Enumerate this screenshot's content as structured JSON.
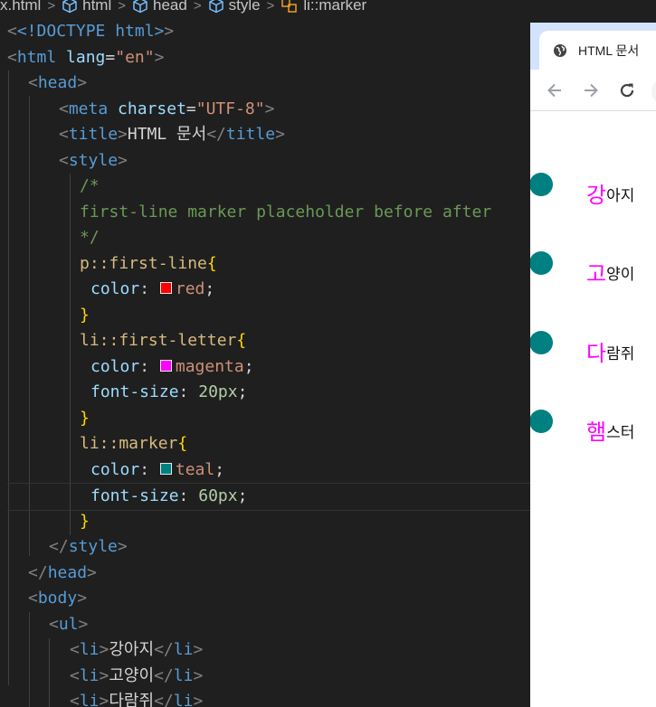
{
  "breadcrumb": {
    "file": "x.html",
    "items": [
      "html",
      "head",
      "style",
      "li::marker"
    ]
  },
  "code": {
    "doctype": "<!DOCTYPE html>",
    "html_open": {
      "tag": "html",
      "attr": "lang",
      "value": "\"en\""
    },
    "head_open": "head",
    "meta": {
      "tag": "meta",
      "attr": "charset",
      "value": "\"UTF-8\""
    },
    "title": {
      "tag": "title",
      "text": "HTML 문서"
    },
    "style_open": "style",
    "comment_open": "/*",
    "comment_text": "first-line marker placeholder before after",
    "comment_close": "*/",
    "rule1": {
      "selector": "p::first-line",
      "prop": "color",
      "value": "red",
      "swatch": "#ff0000"
    },
    "rule2": {
      "selector": "li::first-letter",
      "prop1": "color",
      "value1": "magenta",
      "swatch": "#ff00ff",
      "prop2": "font-size",
      "value2": "20px"
    },
    "rule3": {
      "selector": "li::marker",
      "prop1": "color",
      "value1": "teal",
      "swatch": "#008080",
      "prop2": "font-size",
      "value2": "60px"
    },
    "style_close": "style",
    "head_close": "head",
    "body_open": "body",
    "ul_open": "ul",
    "li_tag": "li",
    "list_items": [
      "강아지",
      "고양이",
      "다람쥐"
    ]
  },
  "browser": {
    "tab_title": "HTML 문서",
    "list": [
      {
        "first": "강",
        "rest": "아지"
      },
      {
        "first": "고",
        "rest": "양이"
      },
      {
        "first": "다",
        "rest": "람쥐"
      },
      {
        "first": "햄",
        "rest": "스터"
      }
    ],
    "marker_color": "#008080",
    "first_letter_color": "#ff00ff"
  },
  "icons": {
    "breadcrumb_tag": "cube-icon",
    "breadcrumb_selector": "css-selector-icon",
    "tab": "globe-icon",
    "back": "arrow-left-icon",
    "forward": "arrow-right-icon",
    "reload": "reload-icon"
  }
}
